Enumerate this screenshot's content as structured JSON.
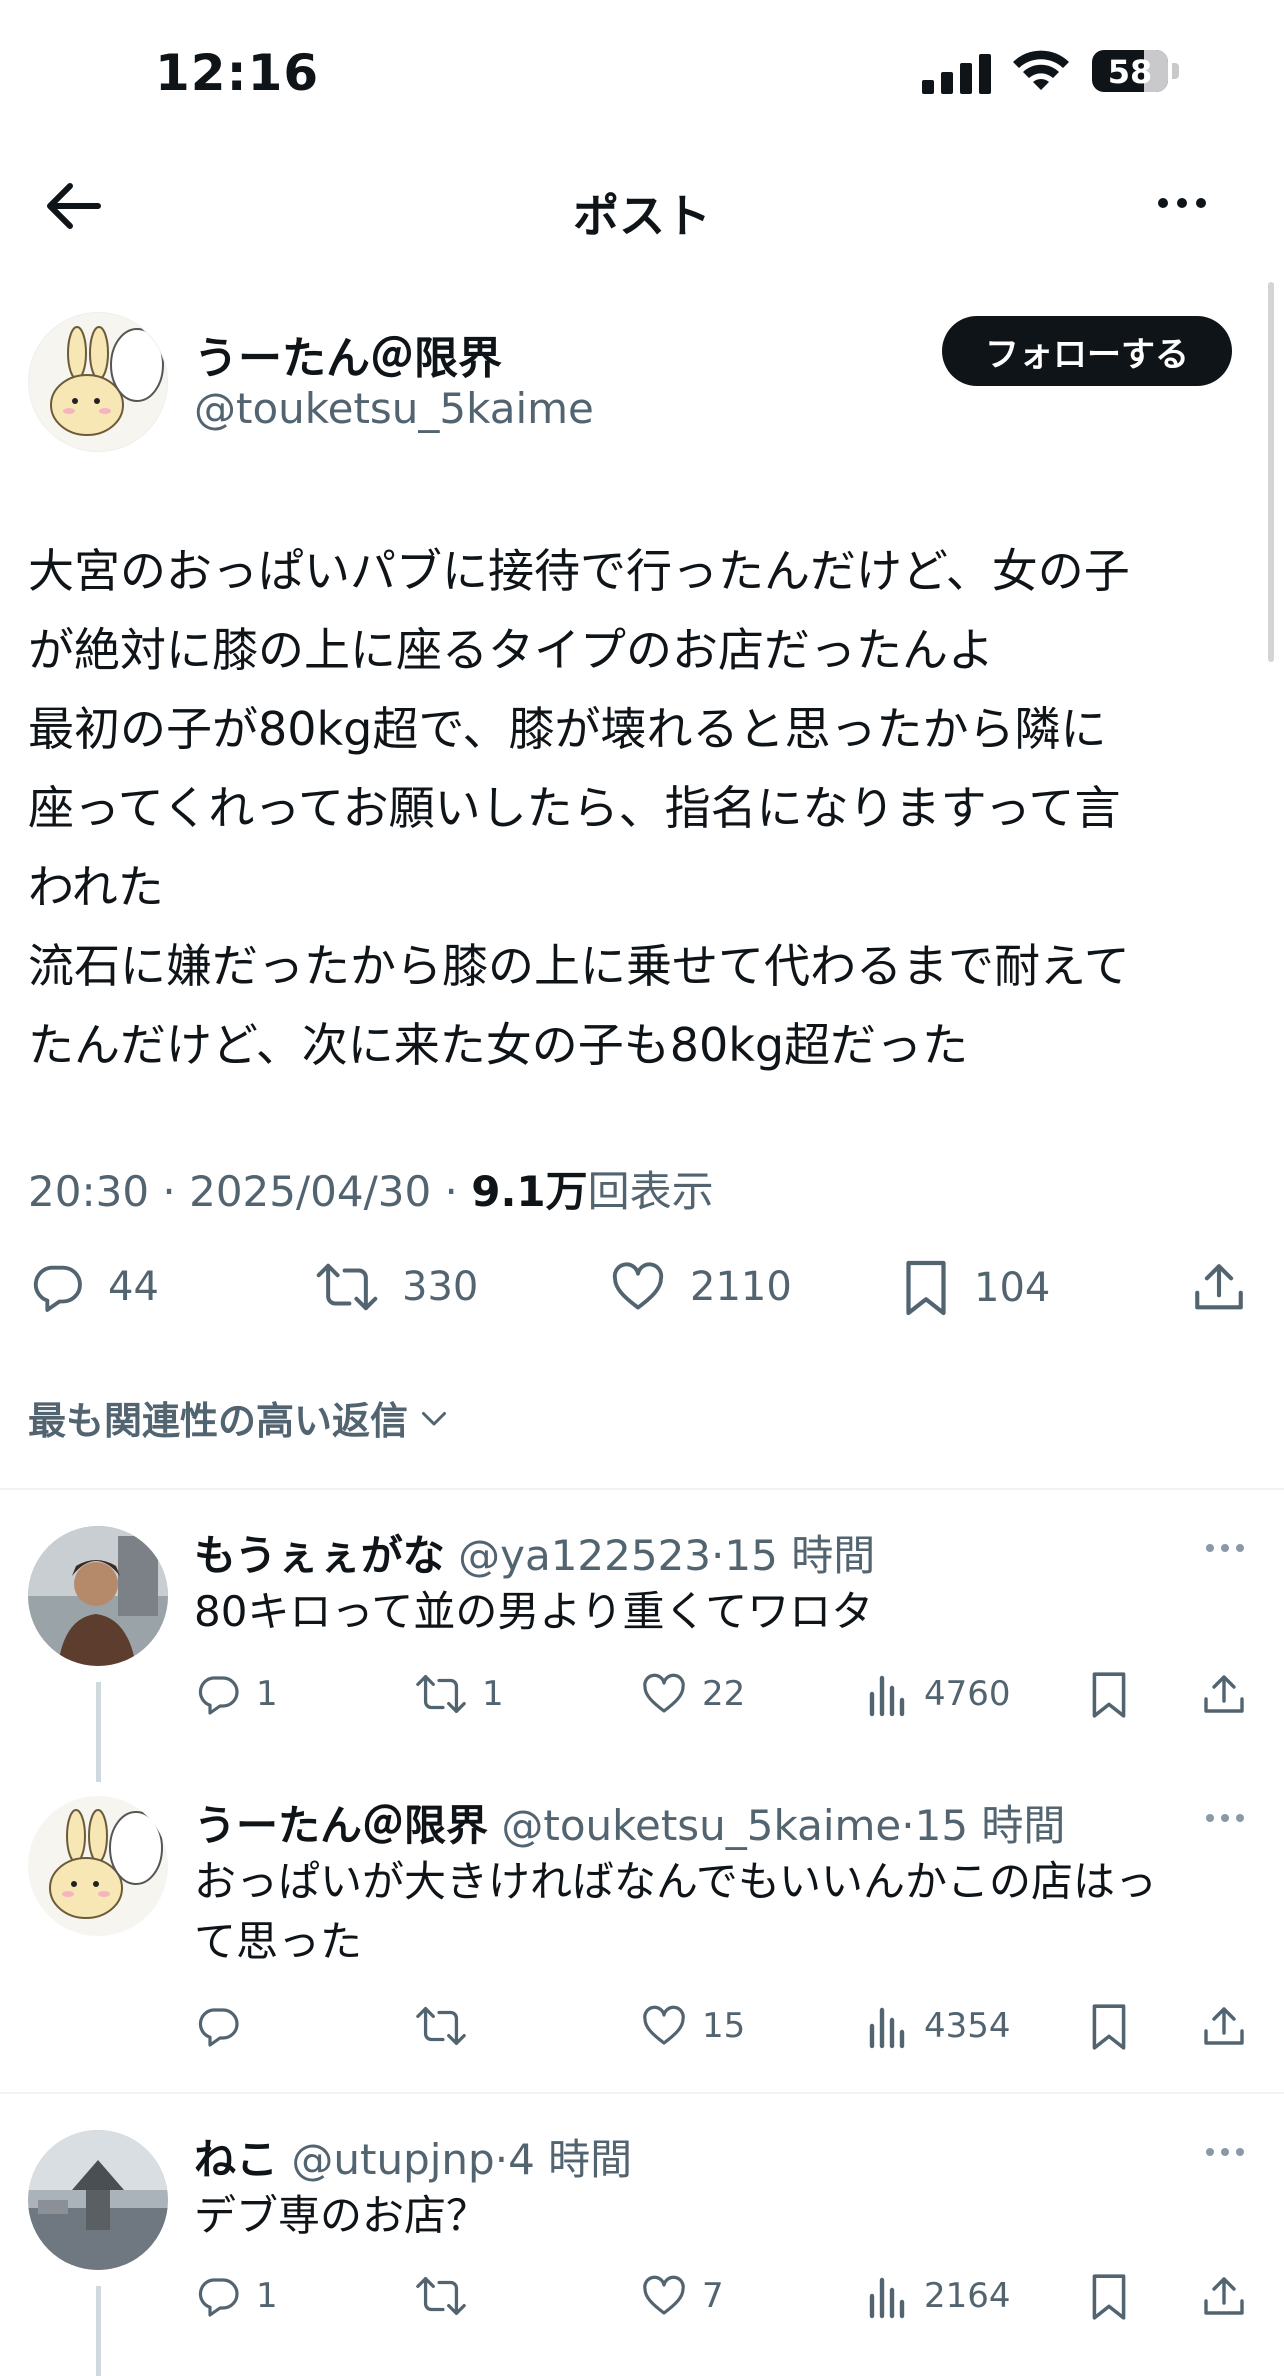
{
  "status_bar": {
    "time": "12:16",
    "battery": "58"
  },
  "nav": {
    "title": "ポスト"
  },
  "post": {
    "author_name": "うーたん＠限界",
    "author_handle": "@touketsu_5kaime",
    "follow_label": "フォローする",
    "text_lines": [
      "大宮のおっぱいパブに接待で行ったんだけど、女の子",
      "が絶対に膝の上に座るタイプのお店だったんよ",
      "最初の子が80kg超で、膝が壊れると思ったから隣に",
      "座ってくれってお願いしたら、指名になりますって言",
      "われた",
      "流石に嫌だったから膝の上に乗せて代わるまで耐えて",
      "たんだけど、次に来た女の子も80kg超だった"
    ],
    "time": "20:30",
    "date": "2025/04/30",
    "views_count": "9.1万",
    "views_label": "回表示",
    "replies": "44",
    "reposts": "330",
    "likes": "2110",
    "bookmarks": "104"
  },
  "sort_label": "最も関連性の高い返信",
  "replies": [
    {
      "name": "もうぇぇがな",
      "handle": "@ya122523",
      "time": "15 時間",
      "text_lines": [
        "80キロって並の男より重くてワロタ"
      ],
      "replies": "1",
      "reposts": "1",
      "likes": "22",
      "views": "4760"
    },
    {
      "name": "うーたん＠限界",
      "handle": "@touketsu_5kaime",
      "time": "15 時間",
      "text_lines": [
        "おっぱいが大きければなんでもいいんかこの店はっ",
        "て思った"
      ],
      "replies": "",
      "reposts": "",
      "likes": "15",
      "views": "4354"
    },
    {
      "name": "ねこ",
      "handle": "@utupjnp",
      "time": "4 時間",
      "text_lines": [
        "デブ専のお店？"
      ],
      "replies": "1",
      "reposts": "",
      "likes": "7",
      "views": "2164"
    }
  ],
  "colors": {
    "text": "#0f1419",
    "secondary": "#536471",
    "divider": "#eff3f4",
    "button_bg": "#0f1419"
  },
  "icons": [
    "back-arrow-icon",
    "more-icon",
    "reply-icon",
    "repost-icon",
    "like-icon",
    "bookmark-icon",
    "share-icon",
    "views-icon",
    "chevron-down-icon"
  ]
}
